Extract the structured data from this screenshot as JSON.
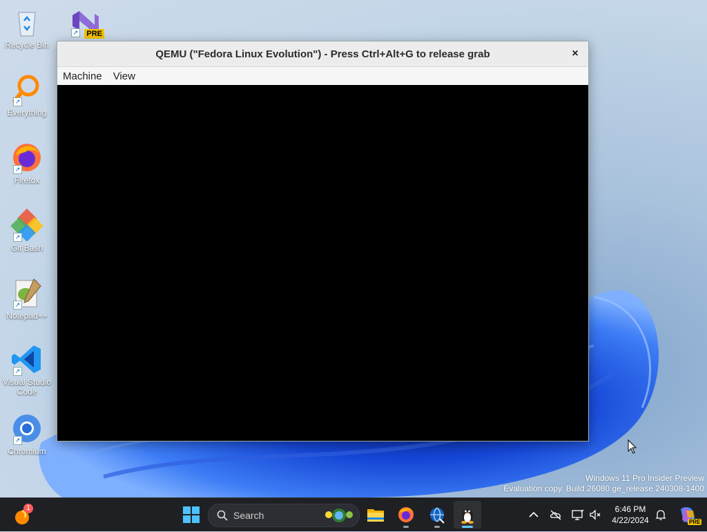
{
  "desktop": {
    "icons": [
      {
        "label": "Recycle Bin"
      },
      {
        "label": "Everything"
      },
      {
        "label": "Firefox"
      },
      {
        "label": "Git Bash"
      },
      {
        "label": "Notepad++"
      },
      {
        "label": "Visual Studio Code"
      },
      {
        "label": "Chromium"
      }
    ],
    "vs_badge": "PRE"
  },
  "qemu": {
    "title": "QEMU (\"Fedora Linux Evolution\") - Press Ctrl+Alt+G to release grab",
    "close_glyph": "×",
    "menu": [
      "Machine",
      "View"
    ]
  },
  "watermark": {
    "line1": "Windows 11 Pro Insider Preview",
    "line2": "Evaluation copy. Build 26080.ge_release.240308-1400"
  },
  "taskbar": {
    "search_label": "Search",
    "notification_count": "1",
    "clock_time": "6:46 PM",
    "clock_date": "4/22/2024",
    "copilot_badge": "PRE"
  },
  "colors": {
    "accent": "#60cdff",
    "taskbar_bg": "#1f2024",
    "bloom_dark": "#0b2a9a",
    "bloom_light": "#3f7cff"
  }
}
